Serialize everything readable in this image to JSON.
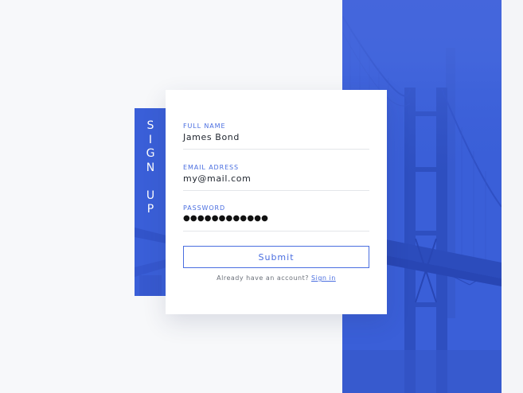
{
  "colors": {
    "accent": "#3a5fd8",
    "label": "#4a6ee0",
    "background": "#f7f8fa",
    "card": "#ffffff"
  },
  "side_tab": {
    "letters_word1": [
      "S",
      "I",
      "G",
      "N"
    ],
    "letters_word2": [
      "U",
      "P"
    ]
  },
  "form": {
    "full_name": {
      "label": "FULL NAME",
      "value": "James Bond"
    },
    "email": {
      "label": "EMAIL ADRESS",
      "value": "my@mail.com"
    },
    "password": {
      "label": "PASSWORD",
      "value": "●●●●●●●●●●●●"
    },
    "submit_label": "Submit",
    "account_prompt": "Already have an account?",
    "signin_label": "Sign in"
  },
  "background_image": {
    "icon": "bridge-photo"
  }
}
